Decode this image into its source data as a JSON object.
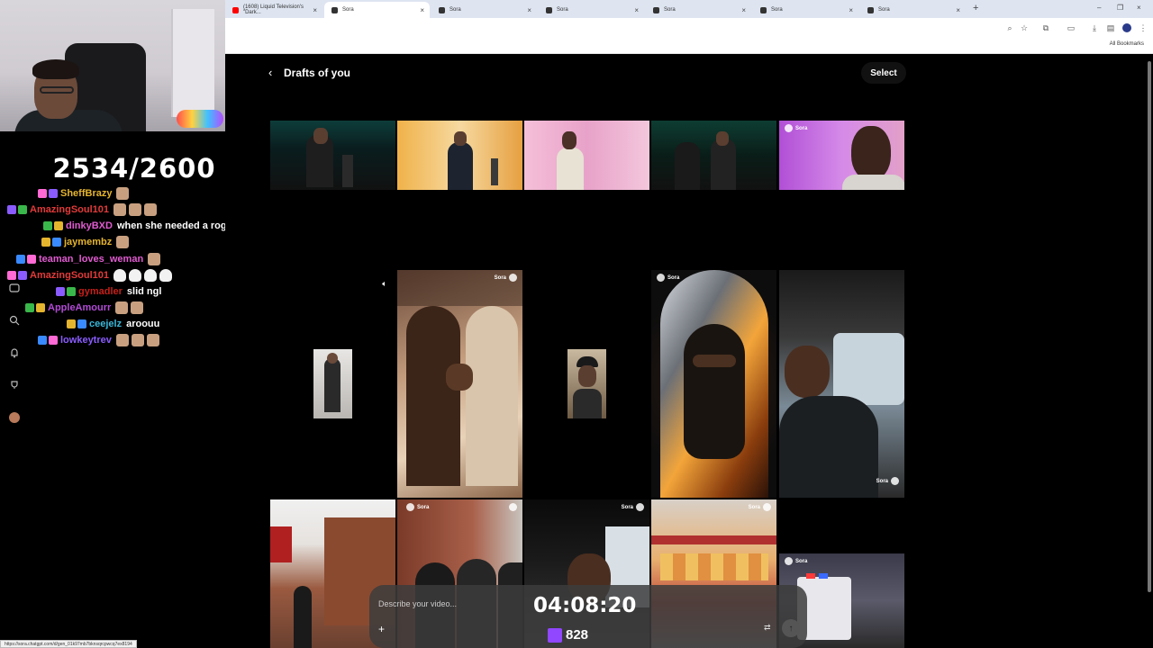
{
  "stream": {
    "counter": "2534/2600",
    "timer": "04:08:20",
    "viewers": "828",
    "chat": [
      {
        "user": "SheffBrazy",
        "color": "#e6b52e",
        "msg": "",
        "emotes": 1,
        "ghost": false
      },
      {
        "user": "AmazingSoul101",
        "color": "#e23a3a",
        "msg": "",
        "emotes": 3,
        "ghost": false
      },
      {
        "user": "dinkyBXD",
        "color": "#e05bd0",
        "msg": "when she needed a rog",
        "emotes": 0,
        "ghost": false
      },
      {
        "user": "jaymembz",
        "color": "#e6b52e",
        "msg": "",
        "emotes": 1,
        "ghost": false
      },
      {
        "user": "teaman_loves_weman",
        "color": "#e05bd0",
        "msg": "",
        "emotes": 1,
        "ghost": false
      },
      {
        "user": "AmazingSoul101",
        "color": "#e23a3a",
        "msg": "",
        "emotes": 4,
        "ghost": true
      },
      {
        "user": "gymadler",
        "color": "#c4201a",
        "msg": "slid ngl",
        "emotes": 0,
        "ghost": false
      },
      {
        "user": "AppleAmourr",
        "color": "#b24bd6",
        "msg": "",
        "emotes": 2,
        "ghost": false
      },
      {
        "user": "ceejelz",
        "color": "#3ab7d8",
        "msg": "aroouu",
        "emotes": 0,
        "ghost": false
      },
      {
        "user": "lowkeytrev",
        "color": "#8a5cff",
        "msg": "",
        "emotes": 3,
        "ghost": false
      }
    ]
  },
  "browser": {
    "tabs": [
      {
        "label": "(1608) Liquid Television's \"Dark...",
        "active": false,
        "fav": "#ff0000"
      },
      {
        "label": "Sora",
        "active": true,
        "fav": "#333333"
      },
      {
        "label": "Sora",
        "active": false,
        "fav": "#333333"
      },
      {
        "label": "Sora",
        "active": false,
        "fav": "#333333"
      },
      {
        "label": "Sora",
        "active": false,
        "fav": "#333333"
      },
      {
        "label": "Sora",
        "active": false,
        "fav": "#333333"
      },
      {
        "label": "Sora",
        "active": false,
        "fav": "#333333"
      }
    ],
    "new_tab": "+",
    "all_bookmarks": "All Bookmarks",
    "status_url": "https://sora.chatgpt.com/d/gen_01k97mb7bknsqrcpwcq7ex8194"
  },
  "page": {
    "back": "‹",
    "title": "Drafts of you",
    "select_label": "Select",
    "watermark": "Sora",
    "prompt_placeholder": "Describe your video..."
  },
  "colors": {
    "accent": "#9146ff",
    "background": "#000000"
  }
}
